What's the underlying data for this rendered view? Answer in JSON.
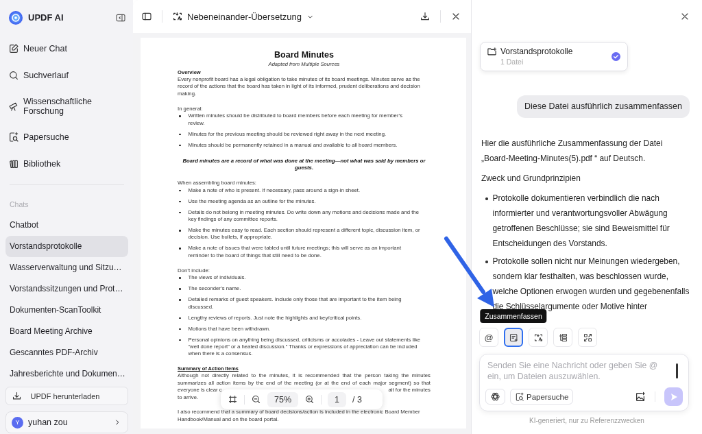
{
  "sidebar": {
    "brand": "UPDF AI",
    "nav": [
      {
        "kind": "new_chat",
        "label": "Neuer Chat"
      },
      {
        "kind": "history",
        "label": "Suchverlauf"
      },
      {
        "kind": "research",
        "label": "Wissenschaftliche Forschung"
      },
      {
        "kind": "paper_search",
        "label": "Papersuche"
      },
      {
        "kind": "library",
        "label": "Bibliothek"
      }
    ],
    "chats_heading": "Chats",
    "chats": [
      {
        "label": "Chatbot",
        "selected": false
      },
      {
        "label": "Vorstandsprotokolle",
        "selected": true
      },
      {
        "label": "Wasserverwaltung und Sitzu…",
        "selected": false
      },
      {
        "label": "Vorstandssitzungen und Prot…",
        "selected": false
      },
      {
        "label": "Dokumenten-ScanToolkit",
        "selected": false
      },
      {
        "label": "Board Meeting Archive",
        "selected": false
      },
      {
        "label": "Gescanntes PDF-Archiv",
        "selected": false
      },
      {
        "label": "Jahresberichte und Dokumen…",
        "selected": false
      }
    ],
    "download_button": "UPDF herunterladen",
    "user": {
      "initial": "Y",
      "name": "yuhan zou"
    }
  },
  "document": {
    "mode": "Nebeneinander-Übersetzung",
    "blocks": [
      {
        "kind": "title",
        "lines": [
          "Board Minutes"
        ]
      },
      {
        "kind": "subtitle",
        "lines": [
          "Adapted from Multiple Sources"
        ]
      },
      {
        "kind": "heading",
        "lines": [
          "Overview"
        ]
      },
      {
        "kind": "paragraph",
        "lines": [
          "Every nonprofit board has a legal obligation to take minutes of its board meetings. Minutes serve as the",
          "record of the actions that the board has taken in light of its informed, prudent deliberations and decision",
          "making."
        ]
      },
      {
        "kind": "paragraph",
        "lines": [
          "In general:"
        ]
      },
      {
        "kind": "bullets",
        "items": [
          [
            "Written minutes should be distributed to board members before each meeting for member’s",
            "review."
          ],
          [
            "Minutes for the previous meeting should be reviewed right away in the next meeting."
          ],
          [
            "Minutes should be permanently retained in a manual and available to all board members."
          ]
        ]
      },
      {
        "kind": "callout",
        "lines": [
          "Board minutes are a record of what was done at the meeting—not what was said by members or",
          "guests."
        ]
      },
      {
        "kind": "paragraph",
        "lines": [
          "When assembling board minutes:"
        ]
      },
      {
        "kind": "bullets",
        "items": [
          [
            "Make a note of who is present. If necessary, pass around a sign-in sheet."
          ],
          [
            "Use the meeting agenda as an outline for the minutes."
          ],
          [
            "Details do not belong in meeting minutes. Do write down any motions and decisions made and the",
            "key findings of any committee reports."
          ],
          [
            "Make the minutes easy to read. Each section should represent a different topic, discussion item, or",
            "decision. Use bullets, if appropriate."
          ],
          [
            "Make a note of issues that were tabled until future meetings; this will serve as an important",
            "reminder to the board of things that still need to be done."
          ]
        ]
      },
      {
        "kind": "paragraph",
        "lines": [
          "Don’t include:"
        ]
      },
      {
        "kind": "bullets",
        "items": [
          [
            "The views of individuals."
          ],
          [
            "The seconder’s name."
          ],
          [
            "Detailed remarks of guest speakers. Include only those that are important to the item being",
            "discussed."
          ],
          [
            "Lengthy reviews of reports. Just note the highlights and key/critical points."
          ],
          [
            "Motions that have been withdrawn."
          ],
          [
            "Personal opinions on anything being discussed, criticisms or accolades - Leave out statements like",
            "“well done report” or a heated discussion.” Thanks or expressions of appreciation can be included",
            "when there is a consensus."
          ]
        ]
      },
      {
        "kind": "section",
        "lines": [
          "Summary of Action Items"
        ]
      },
      {
        "kind": "justified",
        "lines": [
          "Although not directly related to the minutes, it is recommended that the person taking the minutes",
          "summarizes all action items by the end of the meeting (or at the end of each major segment) so that",
          {
            "left": "everyone is clear c",
            "right": "ait for the minutes"
          },
          "to arrive."
        ]
      },
      {
        "kind": "paragraph",
        "lines": [
          "I also recommend that a summary of board decisions/action is included in the electronic Board Member",
          "Handbook/Manual and on the board portal."
        ]
      }
    ],
    "zoom": "75%",
    "page": "1",
    "page_count": "/ 3"
  },
  "chat": {
    "folder": {
      "name": "Vorstandsprotokolle",
      "count": "1 Datei",
      "checked": true
    },
    "user_message": "Diese Datei ausführlich zusammenfassen",
    "answer": [
      {
        "kind": "paragraph",
        "text": "Hier die ausführliche Zusammenfassung der Datei „Board-Meeting-Minutes(5).pdf  “ auf Deutsch."
      },
      {
        "kind": "paragraph",
        "text": "Zweck und Grundprinzipien"
      },
      {
        "kind": "bullets",
        "items": [
          "Protokolle dokumentieren verbindlich die nach informierter und verantwortungsvoller Abwägung getroffenen Beschlüsse; sie sind Beweismittel für Entscheidungen des Vorstands.",
          "Protokolle sollen nicht nur Meinungen wiedergeben, sondern klar festhalten, was beschlossen wurde, welche Optionen erwogen wurden und gegebenenfalls die Schlüsselargumente oder Motive hinter"
        ]
      }
    ],
    "tools": [
      {
        "kind": "mention",
        "label": "@",
        "selected": false
      },
      {
        "kind": "summarize",
        "selected": true
      },
      {
        "kind": "translate",
        "selected": false
      },
      {
        "kind": "outline",
        "selected": false
      },
      {
        "kind": "convert",
        "selected": false
      }
    ],
    "tooltip": "Zusammenfassen",
    "input": {
      "placeholder": "Senden Sie eine Nachricht oder geben Sie @ ein, um Dateien auszuwählen."
    },
    "paper_button": "Papersuche",
    "footer": "KI-generiert, nur zu Referenzzwecken"
  }
}
